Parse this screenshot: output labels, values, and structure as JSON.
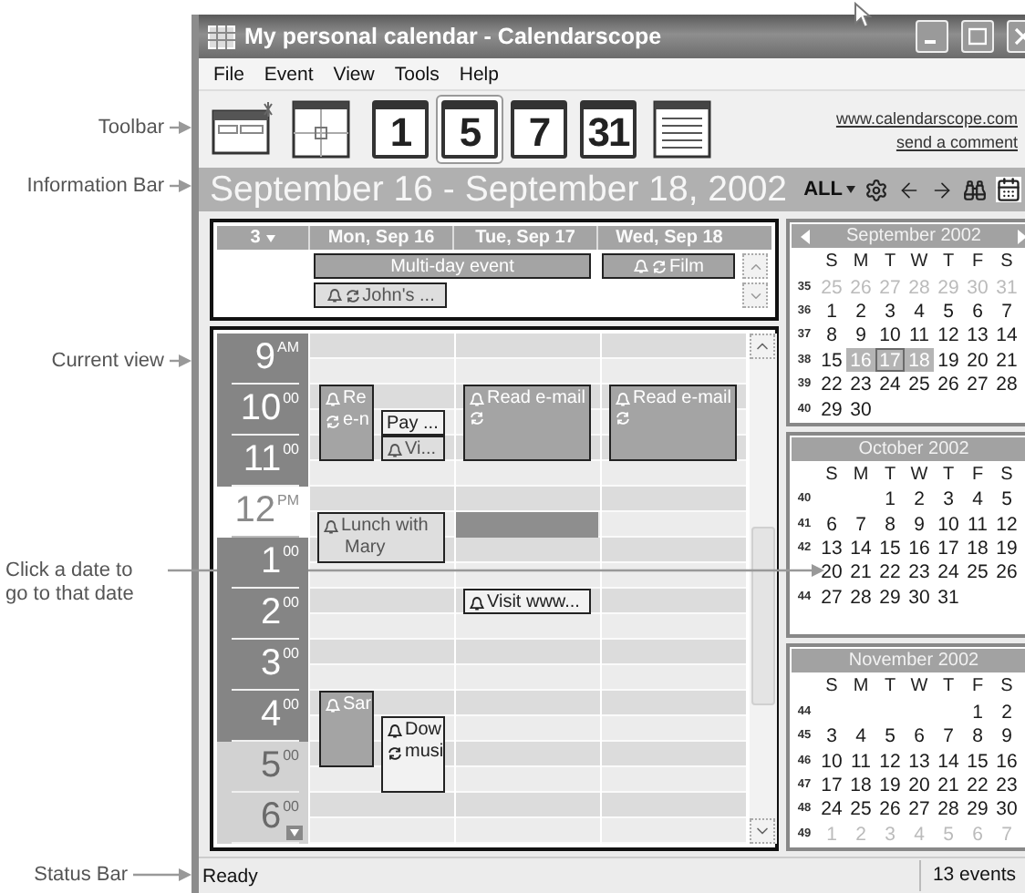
{
  "annotations": [
    {
      "text": "Toolbar"
    },
    {
      "text": "Information Bar"
    },
    {
      "text": "Current view"
    },
    {
      "text": "Click a date to go to that date"
    },
    {
      "text": "Status Bar"
    }
  ],
  "window": {
    "title": "My personal calendar - Calendarscope"
  },
  "menu": [
    "File",
    "Event",
    "View",
    "Tools",
    "Help"
  ],
  "toolbar": {
    "buttons": [
      {
        "kind": "new",
        "selected": false
      },
      {
        "kind": "goto",
        "selected": false
      },
      {
        "kind": "day",
        "label": "1",
        "selected": false
      },
      {
        "kind": "workweek",
        "label": "5",
        "selected": true
      },
      {
        "kind": "week",
        "label": "7",
        "selected": false
      },
      {
        "kind": "month",
        "label": "31",
        "selected": false
      },
      {
        "kind": "list",
        "selected": false
      }
    ],
    "links": [
      "www.calendarscope.com",
      "send a comment"
    ]
  },
  "info_bar": {
    "title": "September 16 - September 18, 2002",
    "filter": "ALL"
  },
  "day_view": {
    "days_count": "3",
    "days": [
      {
        "label": "Mon, Sep 16",
        "events": [
          {
            "kind": "dark",
            "lines": [
              "Re",
              "e-n"
            ],
            "alarm": true,
            "recurring": true
          },
          {
            "kind": "white",
            "lines": [
              "Pay ..."
            ],
            "alarm": false
          },
          {
            "kind": "light",
            "lines": [
              "Vi..."
            ],
            "alarm": true,
            "recurring": false
          },
          {
            "kind": "light",
            "lines": [
              "Lunch with",
              "Mary"
            ],
            "alarm": true,
            "recurring": false
          },
          {
            "kind": "dark",
            "lines": [
              "Sar"
            ],
            "alarm": true,
            "recurring": false
          },
          {
            "kind": "white",
            "lines": [
              "Dow",
              "musi"
            ],
            "alarm": true,
            "recurring": true
          }
        ]
      },
      {
        "label": "Tue, Sep 17",
        "events": [
          {
            "kind": "dark",
            "lines": [
              "Read e-mail"
            ],
            "alarm": true,
            "recurring": true
          },
          {
            "kind": "block"
          },
          {
            "kind": "white",
            "lines": [
              "Visit www..."
            ],
            "alarm": true,
            "recurring": false
          }
        ]
      },
      {
        "label": "Wed, Sep 18",
        "events": [
          {
            "kind": "dark",
            "lines": [
              "Read e-mail"
            ],
            "alarm": true,
            "recurring": true
          }
        ]
      }
    ],
    "all_day_rows": [
      [
        {
          "text": "Multi-day event",
          "kind": "dark",
          "alarm": false,
          "recurring": false
        },
        {
          "text": "Film",
          "kind": "dark",
          "alarm": true,
          "recurring": true
        }
      ],
      [
        {
          "text": "John's ...",
          "kind": "light",
          "alarm": true,
          "recurring": true
        }
      ]
    ],
    "hours": [
      {
        "hour": "9",
        "suffix": "AM",
        "kind": "work"
      },
      {
        "hour": "10",
        "suffix": "00",
        "kind": "work"
      },
      {
        "hour": "11",
        "suffix": "00",
        "kind": "work"
      },
      {
        "hour": "12",
        "suffix": "PM",
        "kind": "current"
      },
      {
        "hour": "1",
        "suffix": "00",
        "kind": "work"
      },
      {
        "hour": "2",
        "suffix": "00",
        "kind": "work"
      },
      {
        "hour": "3",
        "suffix": "00",
        "kind": "work"
      },
      {
        "hour": "4",
        "suffix": "00",
        "kind": "work"
      },
      {
        "hour": "5",
        "suffix": "00",
        "kind": "off"
      },
      {
        "hour": "6",
        "suffix": "00",
        "kind": "off"
      }
    ]
  },
  "mini_calendars": [
    {
      "title": "September 2002",
      "nav": true,
      "weekdays": [
        "S",
        "M",
        "T",
        "W",
        "T",
        "F",
        "S"
      ],
      "weeks": [
        {
          "number": "35",
          "dim": true,
          "days": [
            {
              "d": "25",
              "selected": false,
              "today": false
            },
            {
              "d": "26",
              "selected": false,
              "today": false
            },
            {
              "d": "27",
              "selected": false,
              "today": false
            },
            {
              "d": "28",
              "selected": false,
              "today": false
            },
            {
              "d": "29",
              "selected": false,
              "today": false
            },
            {
              "d": "30",
              "selected": false,
              "today": false
            },
            {
              "d": "31",
              "selected": false,
              "today": false
            }
          ]
        },
        {
          "number": "36",
          "dim": false,
          "days": [
            {
              "d": "1",
              "selected": false,
              "today": false
            },
            {
              "d": "2",
              "selected": false,
              "today": false
            },
            {
              "d": "3",
              "selected": false,
              "today": false
            },
            {
              "d": "4",
              "selected": false,
              "today": false
            },
            {
              "d": "5",
              "selected": false,
              "today": false
            },
            {
              "d": "6",
              "selected": false,
              "today": false
            },
            {
              "d": "7",
              "selected": false,
              "today": false
            }
          ]
        },
        {
          "number": "37",
          "dim": false,
          "days": [
            {
              "d": "8",
              "selected": false,
              "today": false
            },
            {
              "d": "9",
              "selected": false,
              "today": false
            },
            {
              "d": "10",
              "selected": false,
              "today": false
            },
            {
              "d": "11",
              "selected": false,
              "today": false
            },
            {
              "d": "12",
              "selected": false,
              "today": false
            },
            {
              "d": "13",
              "selected": false,
              "today": false
            },
            {
              "d": "14",
              "selected": false,
              "today": false
            }
          ]
        },
        {
          "number": "38",
          "dim": false,
          "days": [
            {
              "d": "15",
              "selected": false,
              "today": false
            },
            {
              "d": "16",
              "selected": true,
              "today": false
            },
            {
              "d": "17",
              "selected": true,
              "today": true
            },
            {
              "d": "18",
              "selected": true,
              "today": false
            },
            {
              "d": "19",
              "selected": false,
              "today": false
            },
            {
              "d": "20",
              "selected": false,
              "today": false
            },
            {
              "d": "21",
              "selected": false,
              "today": false
            }
          ]
        },
        {
          "number": "39",
          "dim": false,
          "days": [
            {
              "d": "22",
              "selected": false,
              "today": false
            },
            {
              "d": "23",
              "selected": false,
              "today": false
            },
            {
              "d": "24",
              "selected": false,
              "today": false
            },
            {
              "d": "25",
              "selected": false,
              "today": false
            },
            {
              "d": "26",
              "selected": false,
              "today": false
            },
            {
              "d": "27",
              "selected": false,
              "today": false
            },
            {
              "d": "28",
              "selected": false,
              "today": false
            }
          ]
        },
        {
          "number": "40",
          "dim": false,
          "days": [
            {
              "d": "29",
              "selected": false,
              "today": false
            },
            {
              "d": "30",
              "selected": false,
              "today": false
            }
          ]
        }
      ]
    },
    {
      "title": "October 2002",
      "nav": false,
      "weekdays": [
        "S",
        "M",
        "T",
        "W",
        "T",
        "F",
        "S"
      ],
      "weeks": [
        {
          "number": "40",
          "dim": false,
          "days": [
            {
              "d": "1",
              "selected": false,
              "today": false
            },
            {
              "d": "2",
              "selected": false,
              "today": false
            },
            {
              "d": "3",
              "selected": false,
              "today": false
            },
            {
              "d": "4",
              "selected": false,
              "today": false
            },
            {
              "d": "5",
              "selected": false,
              "today": false
            }
          ]
        },
        {
          "number": "41",
          "dim": false,
          "days": [
            {
              "d": "6",
              "selected": false,
              "today": false
            },
            {
              "d": "7",
              "selected": false,
              "today": false
            },
            {
              "d": "8",
              "selected": false,
              "today": false
            },
            {
              "d": "9",
              "selected": false,
              "today": false
            },
            {
              "d": "10",
              "selected": false,
              "today": false
            },
            {
              "d": "11",
              "selected": false,
              "today": false
            },
            {
              "d": "12",
              "selected": false,
              "today": false
            }
          ]
        },
        {
          "number": "42",
          "dim": false,
          "days": [
            {
              "d": "13",
              "selected": false,
              "today": false
            },
            {
              "d": "14",
              "selected": false,
              "today": false
            },
            {
              "d": "15",
              "selected": false,
              "today": false
            },
            {
              "d": "16",
              "selected": false,
              "today": false
            },
            {
              "d": "17",
              "selected": false,
              "today": false
            },
            {
              "d": "18",
              "selected": false,
              "today": false
            },
            {
              "d": "19",
              "selected": false,
              "today": false
            }
          ]
        },
        {
          "dim": false,
          "days": [
            {
              "d": "20",
              "selected": false,
              "today": false
            },
            {
              "d": "21",
              "selected": false,
              "today": false
            },
            {
              "d": "22",
              "selected": false,
              "today": false
            },
            {
              "d": "23",
              "selected": false,
              "today": false
            },
            {
              "d": "24",
              "selected": false,
              "today": false
            },
            {
              "d": "25",
              "selected": false,
              "today": false
            },
            {
              "d": "26",
              "selected": false,
              "today": false
            }
          ]
        },
        {
          "number": "44",
          "dim": false,
          "days": [
            {
              "d": "27",
              "selected": false,
              "today": false
            },
            {
              "d": "28",
              "selected": false,
              "today": false
            },
            {
              "d": "29",
              "selected": false,
              "today": false
            },
            {
              "d": "30",
              "selected": false,
              "today": false
            },
            {
              "d": "31",
              "selected": false,
              "today": false
            }
          ]
        }
      ]
    },
    {
      "title": "November 2002",
      "nav": false,
      "weekdays": [
        "S",
        "M",
        "T",
        "W",
        "T",
        "F",
        "S"
      ],
      "weeks": [
        {
          "number": "44",
          "dim": false,
          "days": [
            {
              "d": "1",
              "selected": false,
              "today": false
            },
            {
              "d": "2",
              "selected": false,
              "today": false
            }
          ]
        },
        {
          "number": "45",
          "dim": false,
          "days": [
            {
              "d": "3",
              "selected": false,
              "today": false
            },
            {
              "d": "4",
              "selected": false,
              "today": false
            },
            {
              "d": "5",
              "selected": false,
              "today": false
            },
            {
              "d": "6",
              "selected": false,
              "today": false
            },
            {
              "d": "7",
              "selected": false,
              "today": false
            },
            {
              "d": "8",
              "selected": false,
              "today": false
            },
            {
              "d": "9",
              "selected": false,
              "today": false
            }
          ]
        },
        {
          "number": "46",
          "dim": false,
          "days": [
            {
              "d": "10",
              "selected": false,
              "today": false
            },
            {
              "d": "11",
              "selected": false,
              "today": false
            },
            {
              "d": "12",
              "selected": false,
              "today": false
            },
            {
              "d": "13",
              "selected": false,
              "today": false
            },
            {
              "d": "14",
              "selected": false,
              "today": false
            },
            {
              "d": "15",
              "selected": false,
              "today": false
            },
            {
              "d": "16",
              "selected": false,
              "today": false
            }
          ]
        },
        {
          "number": "47",
          "dim": false,
          "days": [
            {
              "d": "17",
              "selected": false,
              "today": false
            },
            {
              "d": "18",
              "selected": false,
              "today": false
            },
            {
              "d": "19",
              "selected": false,
              "today": false
            },
            {
              "d": "20",
              "selected": false,
              "today": false
            },
            {
              "d": "21",
              "selected": false,
              "today": false
            },
            {
              "d": "22",
              "selected": false,
              "today": false
            },
            {
              "d": "23",
              "selected": false,
              "today": false
            }
          ]
        },
        {
          "number": "48",
          "dim": false,
          "days": [
            {
              "d": "24",
              "selected": false,
              "today": false
            },
            {
              "d": "25",
              "selected": false,
              "today": false
            },
            {
              "d": "26",
              "selected": false,
              "today": false
            },
            {
              "d": "27",
              "selected": false,
              "today": false
            },
            {
              "d": "28",
              "selected": false,
              "today": false
            },
            {
              "d": "29",
              "selected": false,
              "today": false
            },
            {
              "d": "30",
              "selected": false,
              "today": false
            }
          ]
        },
        {
          "number": "49",
          "dim": true,
          "days": [
            {
              "d": "1",
              "selected": false,
              "today": false
            },
            {
              "d": "2",
              "selected": false,
              "today": false
            },
            {
              "d": "3",
              "selected": false,
              "today": false
            },
            {
              "d": "4",
              "selected": false,
              "today": false
            },
            {
              "d": "5",
              "selected": false,
              "today": false
            },
            {
              "d": "6",
              "selected": false,
              "today": false
            },
            {
              "d": "7",
              "selected": false,
              "today": false
            }
          ]
        }
      ]
    }
  ],
  "status_bar": {
    "text": "Ready",
    "count": "13 events"
  }
}
